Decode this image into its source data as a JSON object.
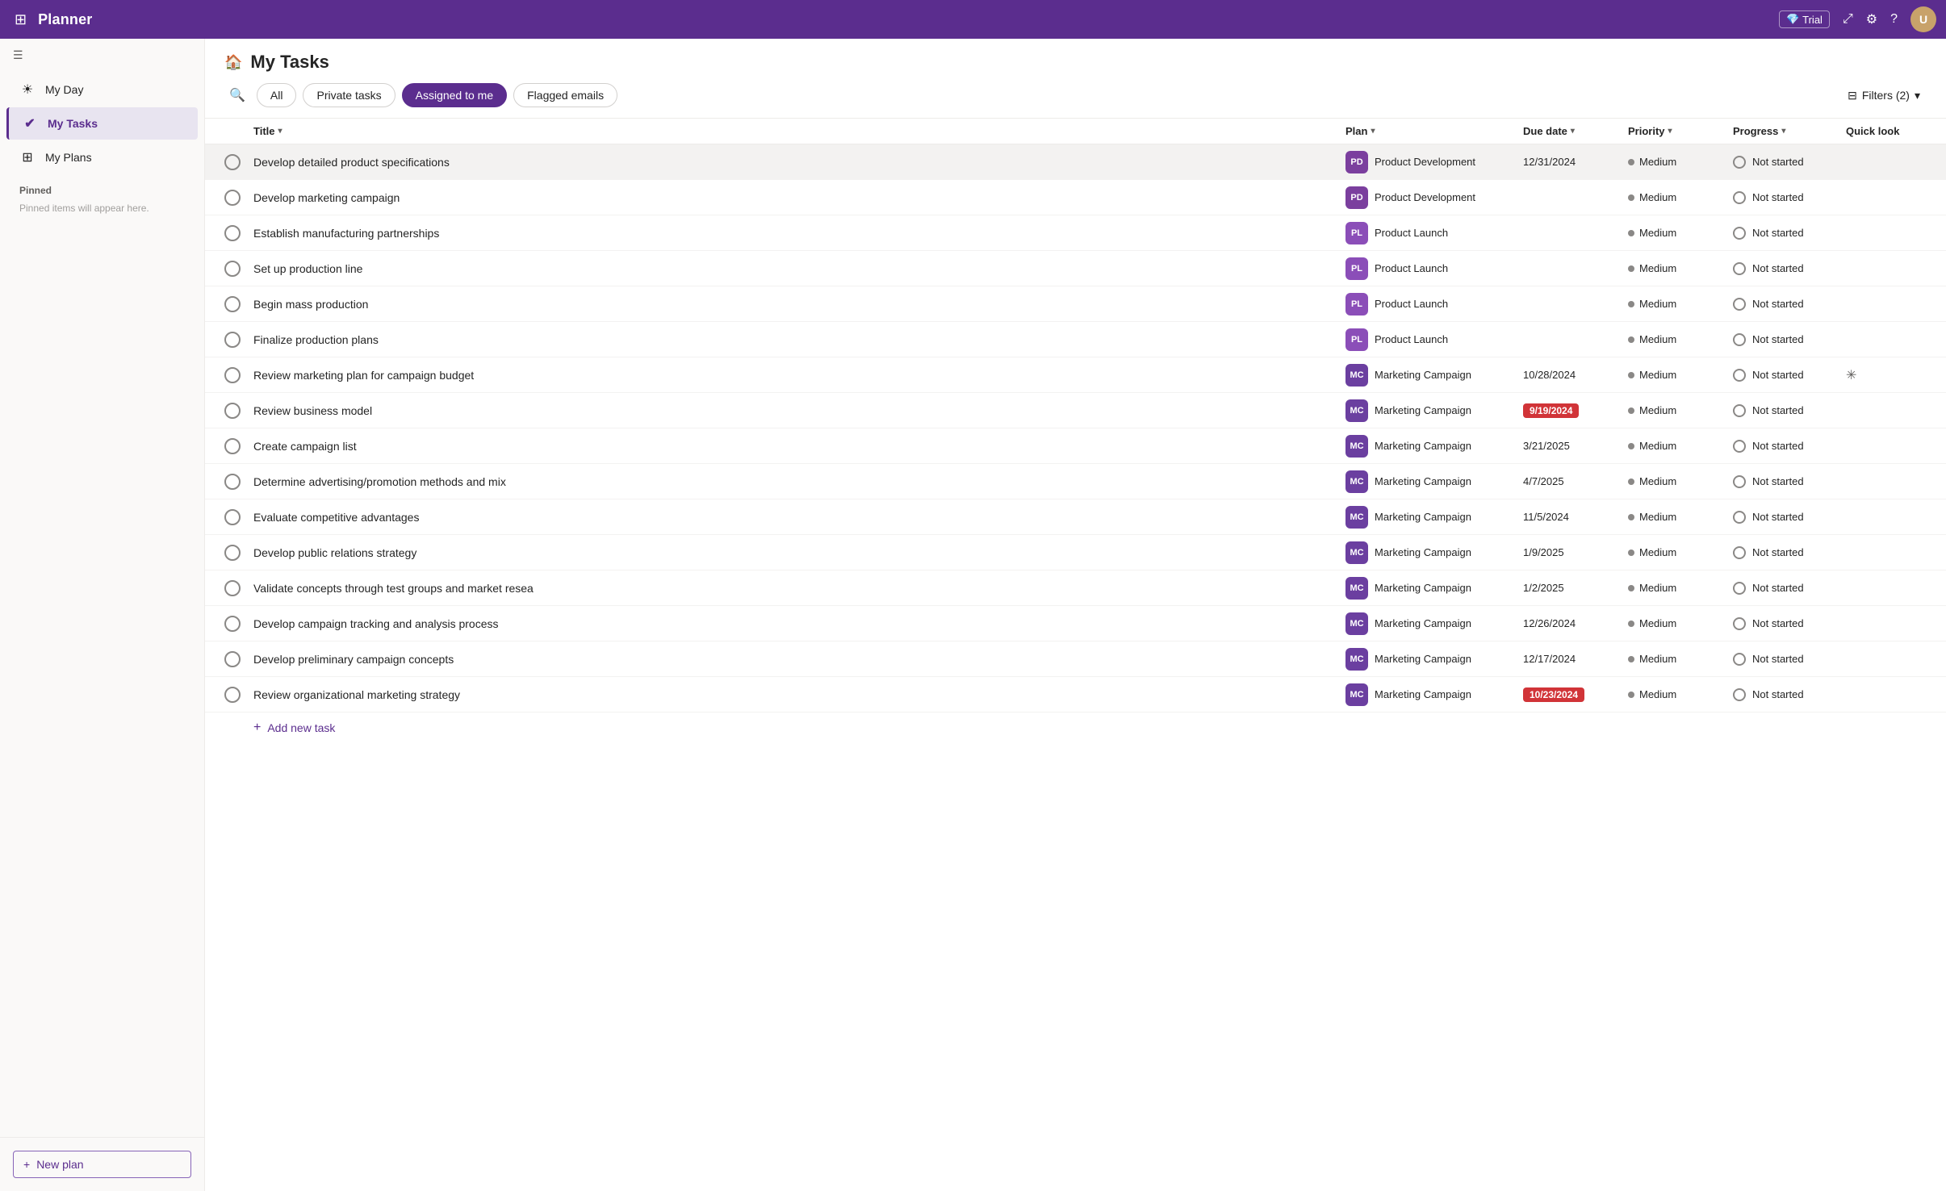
{
  "topbar": {
    "app_name": "Planner",
    "trial_label": "Trial",
    "waffle_icon": "⊞",
    "share_icon": "⤢",
    "settings_icon": "⚙",
    "help_icon": "?"
  },
  "sidebar": {
    "toggle_icon": "☰",
    "items": [
      {
        "id": "my-day",
        "label": "My Day",
        "icon": "☀"
      },
      {
        "id": "my-tasks",
        "label": "My Tasks",
        "icon": "✔",
        "active": true
      },
      {
        "id": "my-plans",
        "label": "My Plans",
        "icon": "⊞"
      }
    ],
    "pinned_label": "Pinned",
    "pinned_empty": "Pinned items will appear here.",
    "new_plan_label": "New plan",
    "new_plan_icon": "+"
  },
  "page": {
    "icon": "🏠",
    "title": "My Tasks",
    "tabs": [
      {
        "id": "all",
        "label": "All",
        "active": false
      },
      {
        "id": "private-tasks",
        "label": "Private tasks",
        "active": false
      },
      {
        "id": "assigned-to-me",
        "label": "Assigned to me",
        "active": true
      },
      {
        "id": "flagged-emails",
        "label": "Flagged emails",
        "active": false
      }
    ],
    "filters_label": "Filters (2)",
    "filters_icon": "⊟"
  },
  "table": {
    "columns": [
      {
        "id": "title",
        "label": "Title",
        "sortable": true
      },
      {
        "id": "plan",
        "label": "Plan",
        "sortable": true
      },
      {
        "id": "due-date",
        "label": "Due date",
        "sortable": true
      },
      {
        "id": "priority",
        "label": "Priority",
        "sortable": true
      },
      {
        "id": "progress",
        "label": "Progress",
        "sortable": true
      },
      {
        "id": "quick-look",
        "label": "Quick look",
        "sortable": false
      }
    ],
    "tasks": [
      {
        "id": 1,
        "title": "Develop detailed product specifications",
        "plan_abbr": "PD",
        "plan_name": "Product Development",
        "plan_class": "pd",
        "due_date": "12/31/2024",
        "due_overdue": false,
        "priority": "Medium",
        "progress": "Not started",
        "hovered": true
      },
      {
        "id": 2,
        "title": "Develop marketing campaign",
        "plan_abbr": "PD",
        "plan_name": "Product Development",
        "plan_class": "pd",
        "due_date": "",
        "due_overdue": false,
        "priority": "Medium",
        "progress": "Not started",
        "hovered": false
      },
      {
        "id": 3,
        "title": "Establish manufacturing partnerships",
        "plan_abbr": "PL",
        "plan_name": "Product Launch",
        "plan_class": "pl",
        "due_date": "",
        "due_overdue": false,
        "priority": "Medium",
        "progress": "Not started",
        "hovered": false
      },
      {
        "id": 4,
        "title": "Set up production line",
        "plan_abbr": "PL",
        "plan_name": "Product Launch",
        "plan_class": "pl",
        "due_date": "",
        "due_overdue": false,
        "priority": "Medium",
        "progress": "Not started",
        "hovered": false
      },
      {
        "id": 5,
        "title": "Begin mass production",
        "plan_abbr": "PL",
        "plan_name": "Product Launch",
        "plan_class": "pl",
        "due_date": "",
        "due_overdue": false,
        "priority": "Medium",
        "progress": "Not started",
        "hovered": false
      },
      {
        "id": 6,
        "title": "Finalize production plans",
        "plan_abbr": "PL",
        "plan_name": "Product Launch",
        "plan_class": "pl",
        "due_date": "",
        "due_overdue": false,
        "priority": "Medium",
        "progress": "Not started",
        "hovered": false
      },
      {
        "id": 7,
        "title": "Review marketing plan for campaign budget",
        "plan_abbr": "MC",
        "plan_name": "Marketing Campaign",
        "plan_class": "mc",
        "due_date": "10/28/2024",
        "due_overdue": false,
        "priority": "Medium",
        "progress": "Not started",
        "hovered": false,
        "has_quicklook": true
      },
      {
        "id": 8,
        "title": "Review business model",
        "plan_abbr": "MC",
        "plan_name": "Marketing Campaign",
        "plan_class": "mc",
        "due_date": "9/19/2024",
        "due_overdue": true,
        "priority": "Medium",
        "progress": "Not started",
        "hovered": false
      },
      {
        "id": 9,
        "title": "Create campaign list",
        "plan_abbr": "MC",
        "plan_name": "Marketing Campaign",
        "plan_class": "mc",
        "due_date": "3/21/2025",
        "due_overdue": false,
        "priority": "Medium",
        "progress": "Not started",
        "hovered": false
      },
      {
        "id": 10,
        "title": "Determine advertising/promotion methods and mix",
        "plan_abbr": "MC",
        "plan_name": "Marketing Campaign",
        "plan_class": "mc",
        "due_date": "4/7/2025",
        "due_overdue": false,
        "priority": "Medium",
        "progress": "Not started",
        "hovered": false
      },
      {
        "id": 11,
        "title": "Evaluate competitive advantages",
        "plan_abbr": "MC",
        "plan_name": "Marketing Campaign",
        "plan_class": "mc",
        "due_date": "11/5/2024",
        "due_overdue": false,
        "priority": "Medium",
        "progress": "Not started",
        "hovered": false
      },
      {
        "id": 12,
        "title": "Develop public relations strategy",
        "plan_abbr": "MC",
        "plan_name": "Marketing Campaign",
        "plan_class": "mc",
        "due_date": "1/9/2025",
        "due_overdue": false,
        "priority": "Medium",
        "progress": "Not started",
        "hovered": false
      },
      {
        "id": 13,
        "title": "Validate concepts through test groups and market resea",
        "plan_abbr": "MC",
        "plan_name": "Marketing Campaign",
        "plan_class": "mc",
        "due_date": "1/2/2025",
        "due_overdue": false,
        "priority": "Medium",
        "progress": "Not started",
        "hovered": false
      },
      {
        "id": 14,
        "title": "Develop campaign tracking and analysis process",
        "plan_abbr": "MC",
        "plan_name": "Marketing Campaign",
        "plan_class": "mc",
        "due_date": "12/26/2024",
        "due_overdue": false,
        "priority": "Medium",
        "progress": "Not started",
        "hovered": false
      },
      {
        "id": 15,
        "title": "Develop preliminary campaign concepts",
        "plan_abbr": "MC",
        "plan_name": "Marketing Campaign",
        "plan_class": "mc",
        "due_date": "12/17/2024",
        "due_overdue": false,
        "priority": "Medium",
        "progress": "Not started",
        "hovered": false
      },
      {
        "id": 16,
        "title": "Review organizational marketing strategy",
        "plan_abbr": "MC",
        "plan_name": "Marketing Campaign",
        "plan_class": "mc",
        "due_date": "10/23/2024",
        "due_overdue": true,
        "priority": "Medium",
        "progress": "Not started",
        "hovered": false
      }
    ],
    "add_task_label": "Add new task"
  }
}
